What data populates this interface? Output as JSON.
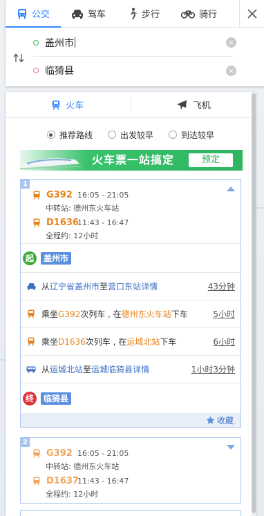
{
  "colors": {
    "accent": "#3385ff",
    "train": "#e8831c",
    "start": "#3eaa3a",
    "end": "#e0313b",
    "place": "#5b8fdf",
    "card_border": "#a9c4ee"
  },
  "modes": [
    {
      "label": "公交",
      "icon": "bus-icon",
      "active": true
    },
    {
      "label": "驾车",
      "icon": "car-icon",
      "active": false
    },
    {
      "label": "步行",
      "icon": "walk-icon",
      "active": false
    },
    {
      "label": "骑行",
      "icon": "bike-icon",
      "active": false
    }
  ],
  "search": {
    "origin": "盖州市",
    "destination": "临猗县"
  },
  "sub_tabs": [
    {
      "label": "火车",
      "active": true
    },
    {
      "label": "飞机",
      "active": false
    }
  ],
  "sort_options": [
    {
      "label": "推荐路线",
      "selected": true
    },
    {
      "label": "出发较早",
      "selected": false
    },
    {
      "label": "到达较早",
      "selected": false
    }
  ],
  "banner": {
    "text": "火车票一站搞定",
    "button": "预定"
  },
  "routes": [
    {
      "index": "1",
      "trains": [
        {
          "no": "G392",
          "time": "16:05 - 21:05"
        },
        {
          "no": "D1636",
          "time": "11:43 - 16:47"
        }
      ],
      "transfer": "中转站: 德州东火车站",
      "total": "全程约: 12小时",
      "start": {
        "badge": "起",
        "place": "盖州市"
      },
      "steps": [
        {
          "p1": "从 ",
          "a": "辽宁省盖州市",
          "p2": " 至 ",
          "b": "营口东站",
          "link": " 详情",
          "duration": "43分钟"
        },
        {
          "p1": "乘坐 ",
          "train": "G392",
          "p2": "次列车 , 在 ",
          "station": "德州东火车站",
          "p3": " 下车",
          "duration": "5小时"
        },
        {
          "p1": "乘坐 ",
          "train": "D1636",
          "p2": "次列车 , 在 ",
          "station": "运城北站",
          "p3": " 下车",
          "duration": "6小时"
        },
        {
          "p1": "从 ",
          "a": "运城北站",
          "p2": " 至 ",
          "b": "运城临猗县",
          "link": " 详情",
          "duration": "1小时3分钟"
        }
      ],
      "end": {
        "badge": "终",
        "place": "临猗县"
      },
      "collect": "收藏"
    },
    {
      "index": "2",
      "trains": [
        {
          "no": "G392",
          "time": "16:05 - 21:05"
        },
        {
          "no": "D1637",
          "time": "11:43 - 16:47"
        }
      ],
      "transfer": "中转站: 德州东火车站",
      "total": "全程约: 12小时"
    }
  ]
}
